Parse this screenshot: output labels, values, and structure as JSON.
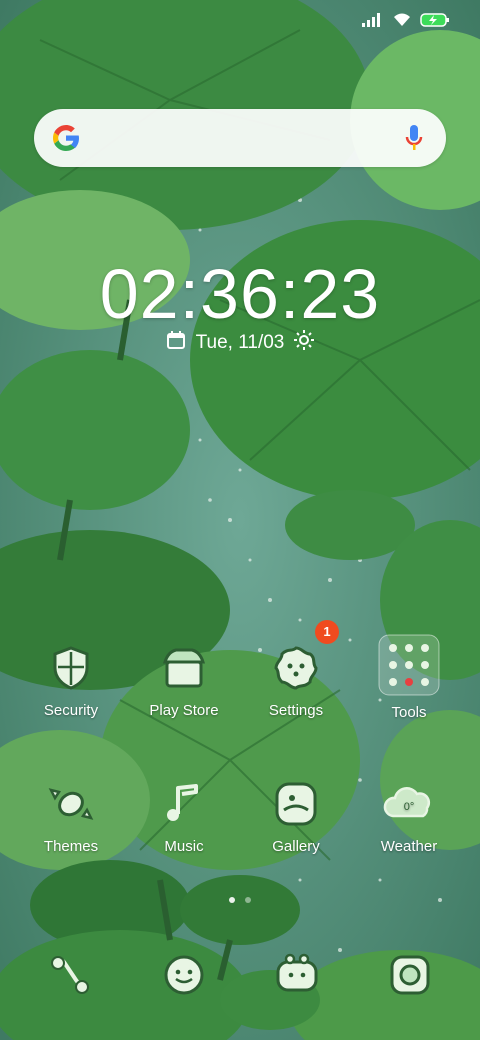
{
  "status_bar": {
    "signal_icon": "signal-bars-icon",
    "wifi_icon": "wifi-icon",
    "battery_icon": "battery-charging-icon",
    "battery_color": "#3ddc5a"
  },
  "search": {
    "logo_icon": "google-g-icon",
    "mic_icon": "microphone-icon"
  },
  "clock": {
    "time": "02:36:23",
    "date": "Tue, 11/03",
    "calendar_icon": "calendar-icon",
    "weather_icon": "sun-icon"
  },
  "apps": [
    {
      "label": "Security",
      "icon": "shield-icon"
    },
    {
      "label": "Play Store",
      "icon": "store-icon"
    },
    {
      "label": "Settings",
      "icon": "gear-icon",
      "badge": "1"
    },
    {
      "label": "Tools",
      "icon": "folder-icon"
    },
    {
      "label": "Themes",
      "icon": "candy-icon"
    },
    {
      "label": "Music",
      "icon": "music-note-icon"
    },
    {
      "label": "Gallery",
      "icon": "gallery-icon"
    },
    {
      "label": "Weather",
      "icon": "cloud-icon",
      "temp": "0°"
    }
  ],
  "page_indicator": {
    "pages": 2,
    "current": 1
  },
  "dock": [
    {
      "name": "phone",
      "icon": "phone-icon"
    },
    {
      "name": "messages",
      "icon": "smile-bubble-icon"
    },
    {
      "name": "browser",
      "icon": "globe-icon"
    },
    {
      "name": "camera",
      "icon": "camera-icon"
    }
  ],
  "colors": {
    "leaf_dark": "#2f7a3a",
    "leaf_light": "#5fa858",
    "water": "#4e8f78",
    "badge": "#f04b1f"
  }
}
